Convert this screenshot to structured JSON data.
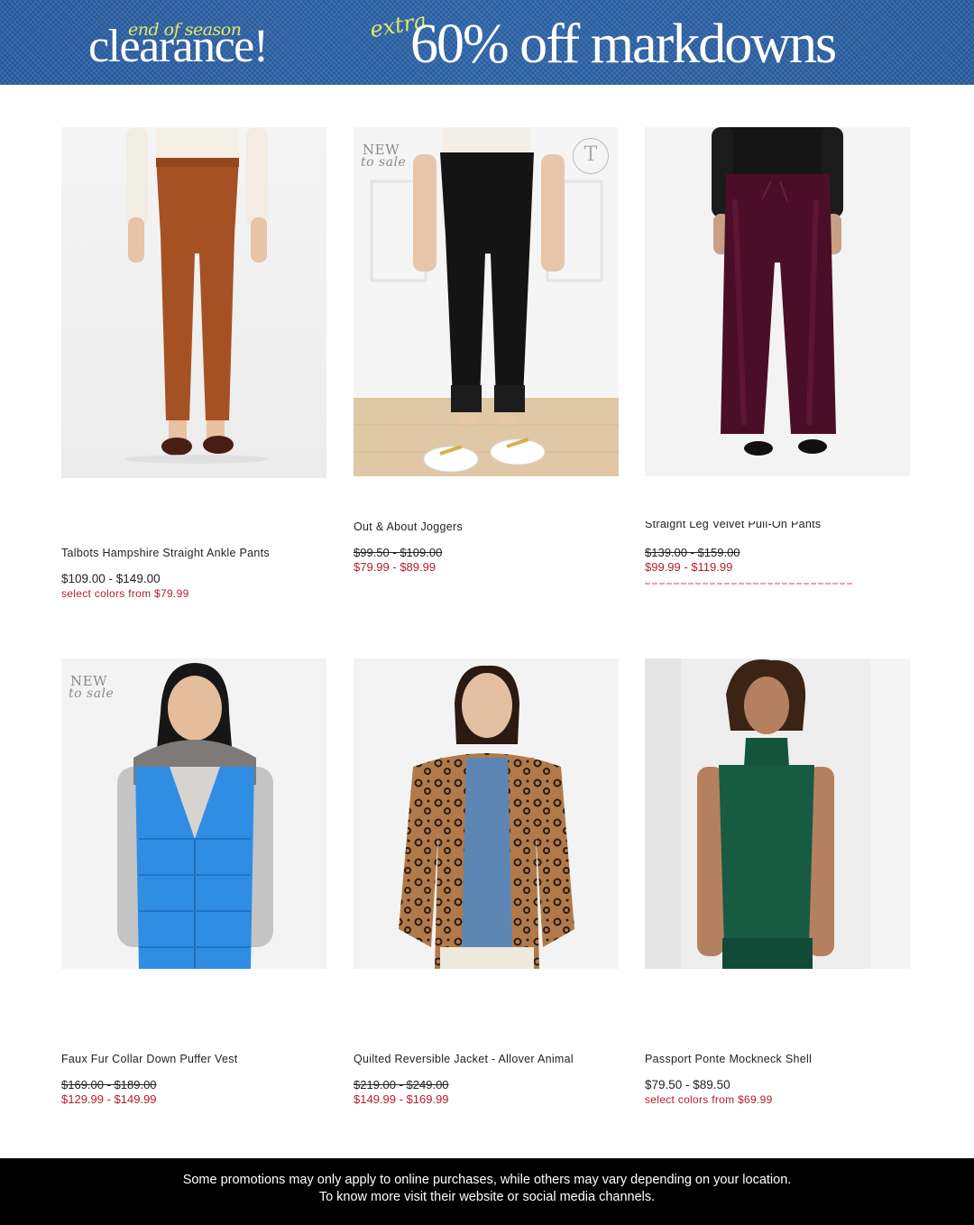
{
  "banner": {
    "tagline": "end of season",
    "headline": "clearance!",
    "extra": "extra",
    "offer": "60% off markdowns",
    "bg_color": "#2f67ad",
    "accent_color": "#e3e86c"
  },
  "products": [
    {
      "name": "Talbots Hampshire Straight Ankle Pants",
      "price": "$109.00 - $149.00",
      "note": "select colors from $79.99",
      "image": "orange-ankle-pants-photo"
    },
    {
      "badge_top": "NEW",
      "badge_bottom": "to sale",
      "logo": "T",
      "name": "Out & About Joggers",
      "original_price": "$99.50 - $109.00",
      "sale_price": "$79.99 - $89.99",
      "image": "black-joggers-photo"
    },
    {
      "name": "Straight Leg Velvet Pull-On Pants",
      "original_price": "$139.00 - $159.00",
      "sale_price": "$99.99 - $119.99",
      "image": "velvet-pants-photo"
    },
    {
      "badge_top": "NEW",
      "badge_bottom": "to sale",
      "name": "Faux Fur Collar Down Puffer Vest",
      "original_price": "$169.00 - $189.00",
      "sale_price": "$129.99 - $149.99",
      "image": "blue-puffer-vest-photo"
    },
    {
      "name": "Quilted Reversible Jacket - Allover Animal",
      "original_price": "$219.00 - $249.00",
      "sale_price": "$149.99 - $169.99",
      "image": "leopard-jacket-photo"
    },
    {
      "name": "Passport Ponte Mockneck Shell",
      "price": "$79.50 - $89.50",
      "note": "select colors from $69.99",
      "image": "green-mockneck-photo"
    }
  ],
  "footer": {
    "line1": "Some promotions may only apply to online purchases, while others may vary depending on your location.",
    "line2": "To know more visit their website or social media channels."
  },
  "colors": {
    "sale_red": "#b0202e",
    "footer_bg": "#000000"
  }
}
